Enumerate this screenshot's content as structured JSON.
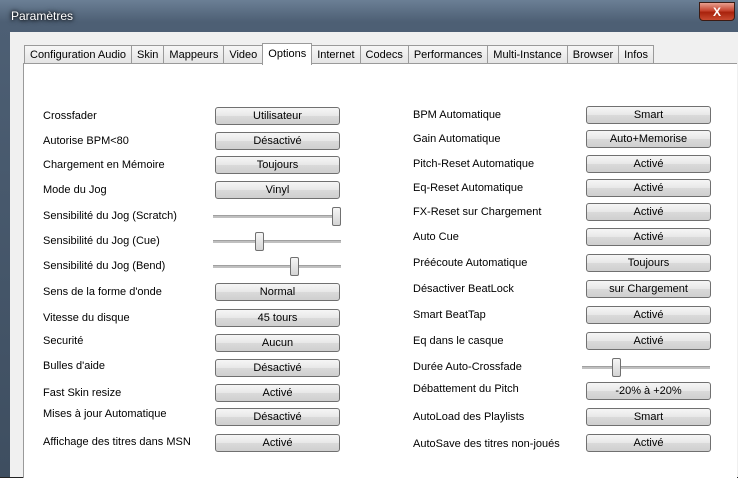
{
  "window": {
    "title": "Paramètres",
    "close_label": "X"
  },
  "tabs": [
    {
      "label": "Configuration Audio"
    },
    {
      "label": "Skin"
    },
    {
      "label": "Mappeurs"
    },
    {
      "label": "Video"
    },
    {
      "label": "Options",
      "active": true
    },
    {
      "label": "Internet"
    },
    {
      "label": "Codecs"
    },
    {
      "label": "Performances"
    },
    {
      "label": "Multi-Instance"
    },
    {
      "label": "Browser"
    },
    {
      "label": "Infos"
    }
  ],
  "left": [
    {
      "label": "Crossfader",
      "type": "button",
      "value": "Utilisateur"
    },
    {
      "label": "Autorise BPM<80",
      "type": "button",
      "value": "Désactivé"
    },
    {
      "label": "Chargement en Mémoire",
      "type": "button",
      "value": "Toujours"
    },
    {
      "label": "Mode du Jog",
      "type": "button",
      "value": "Vinyl"
    },
    {
      "label": "Sensibilité du Jog (Scratch)",
      "type": "slider",
      "level": 1.0
    },
    {
      "label": "Sensibilité du Jog (Cue)",
      "type": "slider",
      "level": 0.35
    },
    {
      "label": "Sensibilité du Jog (Bend)",
      "type": "slider",
      "level": 0.65
    },
    {
      "label": "Sens de la forme d'onde",
      "type": "button",
      "value": "Normal"
    },
    {
      "label": "Vitesse du disque",
      "type": "button",
      "value": "45 tours"
    },
    {
      "label": "Securité",
      "type": "button",
      "value": "Aucun"
    },
    {
      "label": "Bulles d'aide",
      "type": "button",
      "value": "Désactivé"
    },
    {
      "label": "Fast Skin resize",
      "type": "button",
      "value": "Activé"
    },
    {
      "label": "Mises à jour Automatique",
      "type": "button",
      "value": "Désactivé"
    },
    {
      "label": "Affichage des titres dans MSN",
      "type": "button",
      "value": "Activé"
    }
  ],
  "right": [
    {
      "label": "BPM Automatique",
      "type": "button",
      "value": "Smart"
    },
    {
      "label": "Gain Automatique",
      "type": "button",
      "value": "Auto+Memorise"
    },
    {
      "label": "Pitch-Reset Automatique",
      "type": "button",
      "value": "Activé"
    },
    {
      "label": "Eq-Reset Automatique",
      "type": "button",
      "value": "Activé"
    },
    {
      "label": "FX-Reset sur Chargement",
      "type": "button",
      "value": "Activé"
    },
    {
      "label": "Auto Cue",
      "type": "button",
      "value": "Activé"
    },
    {
      "label": "Préécoute Automatique",
      "type": "button",
      "value": "Toujours"
    },
    {
      "label": "Désactiver BeatLock",
      "type": "button",
      "value": "sur Chargement"
    },
    {
      "label": "Smart BeatTap",
      "type": "button",
      "value": "Activé"
    },
    {
      "label": "Eq dans le casque",
      "type": "button",
      "value": "Activé"
    },
    {
      "label": "Durée Auto-Crossfade",
      "type": "slider",
      "level": 0.25
    },
    {
      "label": "Débattement du Pitch",
      "type": "button",
      "value": "-20% à +20%"
    },
    {
      "label": "AutoLoad des Playlists",
      "type": "button",
      "value": "Smart"
    },
    {
      "label": "AutoSave des titres non-joués",
      "type": "button",
      "value": "Activé"
    }
  ]
}
